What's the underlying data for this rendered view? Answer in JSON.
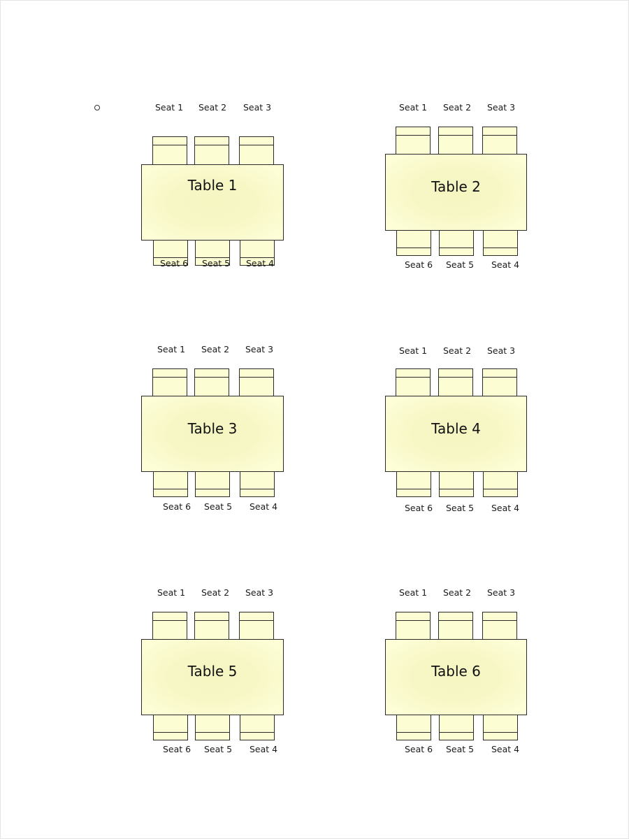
{
  "document": {
    "bullet_icon": "circle-bullet-icon",
    "colors": {
      "table_fill": "#f7f7c6",
      "chair_fill": "#fdfdd3",
      "outline": "#2a2a2a",
      "text": "#111111"
    },
    "tables": [
      {
        "name": "Table 1",
        "top_seats": [
          "Seat 1",
          "Seat 2",
          "Seat 3"
        ],
        "bottom_seats": [
          "Seat 6",
          "Seat 5",
          "Seat 4"
        ]
      },
      {
        "name": "Table 2",
        "top_seats": [
          "Seat 1",
          "Seat 2",
          "Seat 3"
        ],
        "bottom_seats": [
          "Seat 6",
          "Seat 5",
          "Seat 4"
        ]
      },
      {
        "name": "Table 3",
        "top_seats": [
          "Seat 1",
          "Seat 2",
          "Seat 3"
        ],
        "bottom_seats": [
          "Seat 6",
          "Seat 5",
          "Seat 4"
        ]
      },
      {
        "name": "Table 4",
        "top_seats": [
          "Seat 1",
          "Seat 2",
          "Seat 3"
        ],
        "bottom_seats": [
          "Seat 6",
          "Seat 5",
          "Seat 4"
        ]
      },
      {
        "name": "Table 5",
        "top_seats": [
          "Seat 1",
          "Seat 2",
          "Seat 3"
        ],
        "bottom_seats": [
          "Seat 6",
          "Seat 5",
          "Seat 4"
        ]
      },
      {
        "name": "Table 6",
        "top_seats": [
          "Seat 1",
          "Seat 2",
          "Seat 3"
        ],
        "bottom_seats": [
          "Seat 6",
          "Seat 5",
          "Seat 4"
        ]
      }
    ]
  }
}
